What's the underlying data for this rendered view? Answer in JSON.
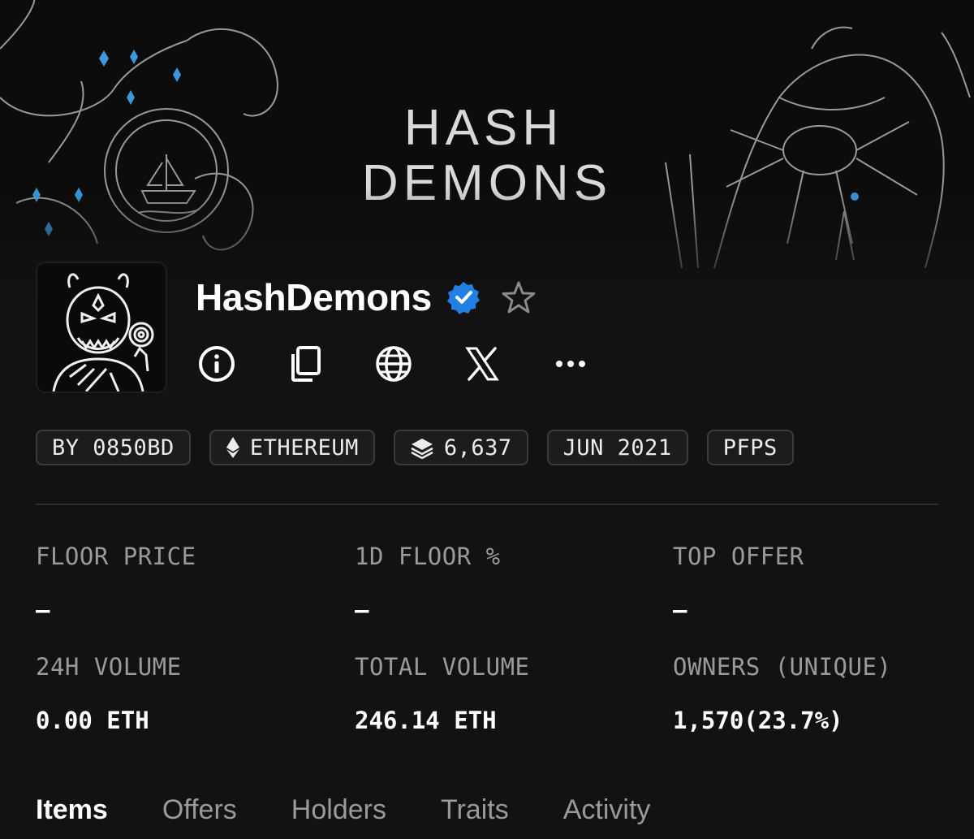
{
  "banner": {
    "logo_line1": "HASH",
    "logo_line2": "DEMONS"
  },
  "collection": {
    "name": "HashDemons",
    "verified": true,
    "favorite": false,
    "icons": [
      "info-icon",
      "copy-icon",
      "globe-icon",
      "x-icon",
      "more-icon"
    ]
  },
  "chips": {
    "creator": "BY 0850BD",
    "chain": "ETHEREUM",
    "items": "6,637",
    "date": "JUN 2021",
    "category": "PFPS"
  },
  "stats": [
    {
      "label": "FLOOR PRICE",
      "value": "–"
    },
    {
      "label": "1D FLOOR %",
      "value": "–"
    },
    {
      "label": "TOP OFFER",
      "value": "–"
    },
    {
      "label": "24H VOLUME",
      "value": "0.00 ETH"
    },
    {
      "label": "TOTAL VOLUME",
      "value": "246.14 ETH"
    },
    {
      "label": "OWNERS (UNIQUE)",
      "value": "1,570(23.7%)"
    }
  ],
  "tabs": [
    {
      "label": "Items",
      "active": true
    },
    {
      "label": "Offers",
      "active": false
    },
    {
      "label": "Holders",
      "active": false
    },
    {
      "label": "Traits",
      "active": false
    },
    {
      "label": "Activity",
      "active": false
    }
  ],
  "colors": {
    "background": "#121212",
    "verified_blue": "#2081e2",
    "crystal_blue": "#3fa9f5",
    "muted_text": "#9a9a9a",
    "chip_border": "#3b3b3b"
  }
}
